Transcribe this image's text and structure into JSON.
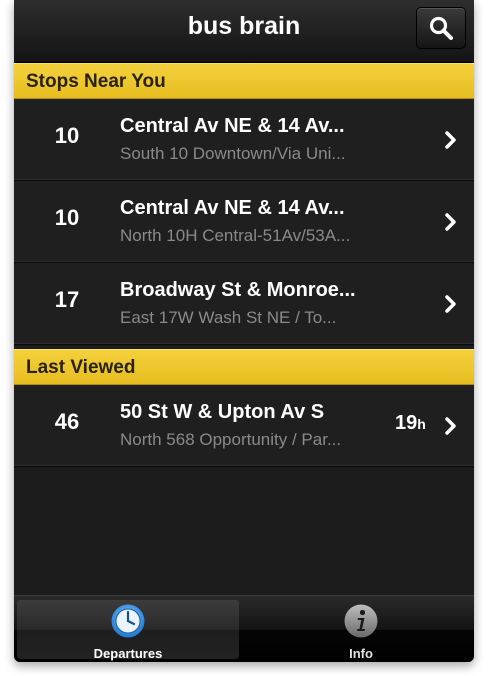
{
  "app": {
    "title": "bus brain"
  },
  "colors": {
    "accent": "#F2CB30",
    "background": "#1C1C1C",
    "subtext": "#8A8A8A"
  },
  "sections": [
    {
      "header": "Stops Near You",
      "rows": [
        {
          "route": "10",
          "stop": "Central Av NE & 14 Av...",
          "sub": "South 10 Downtown/Via Uni..."
        },
        {
          "route": "10",
          "stop": "Central Av NE & 14 Av...",
          "sub": "North 10H Central-51Av/53A..."
        },
        {
          "route": "17",
          "stop": "Broadway St & Monroe...",
          "sub": "East 17W  Wash St NE / To..."
        }
      ]
    },
    {
      "header": "Last Viewed",
      "rows": [
        {
          "route": "46",
          "stop": "50 St W & Upton Av S",
          "sub": "North 568  Opportunity / Par...",
          "time": "19",
          "time_unit": "h"
        }
      ]
    }
  ],
  "tabbar": {
    "tabs": [
      {
        "label": "Departures",
        "icon": "clock-icon",
        "active": true
      },
      {
        "label": "Info",
        "icon": "info-icon",
        "active": false
      }
    ]
  }
}
